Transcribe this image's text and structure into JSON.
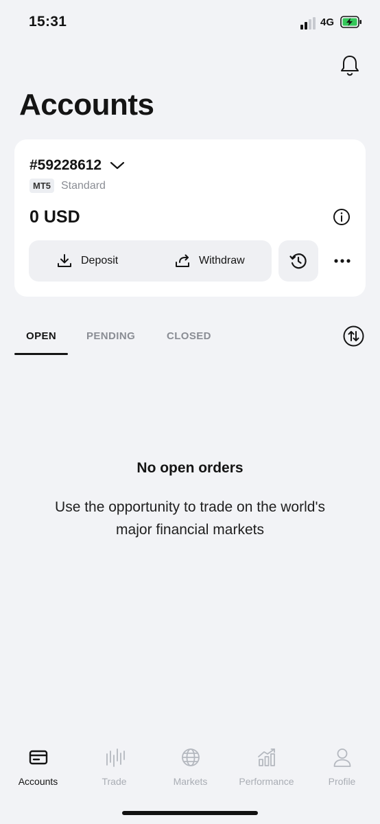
{
  "status_bar": {
    "time": "15:31",
    "network": "4G",
    "icons": [
      "signal-icon",
      "battery-charging-icon"
    ]
  },
  "header": {
    "title": "Accounts",
    "notification_icon": "bell-icon"
  },
  "account_card": {
    "account_number": "#59228612",
    "platform": "MT5",
    "account_type": "Standard",
    "balance": "0 USD",
    "actions": {
      "deposit_label": "Deposit",
      "withdraw_label": "Withdraw"
    },
    "icons": [
      "chevron-down-icon",
      "info-icon",
      "download-icon",
      "share-icon",
      "history-icon",
      "more-icon"
    ]
  },
  "tabs": [
    {
      "label": "OPEN",
      "active": true
    },
    {
      "label": "PENDING",
      "active": false
    },
    {
      "label": "CLOSED",
      "active": false
    }
  ],
  "sort_icon": "sort-arrows-icon",
  "empty_state": {
    "title": "No open orders",
    "description": "Use the opportunity to trade on the world's major financial markets"
  },
  "bottom_nav": [
    {
      "label": "Accounts",
      "icon": "wallet-icon",
      "active": true
    },
    {
      "label": "Trade",
      "icon": "candles-icon",
      "active": false
    },
    {
      "label": "Markets",
      "icon": "globe-icon",
      "active": false
    },
    {
      "label": "Performance",
      "icon": "bar-chart-icon",
      "active": false
    },
    {
      "label": "Profile",
      "icon": "user-icon",
      "active": false
    }
  ],
  "colors": {
    "background": "#f2f3f6",
    "card": "#ffffff",
    "text": "#141414",
    "muted": "#8a8d94",
    "battery": "#34c759"
  }
}
